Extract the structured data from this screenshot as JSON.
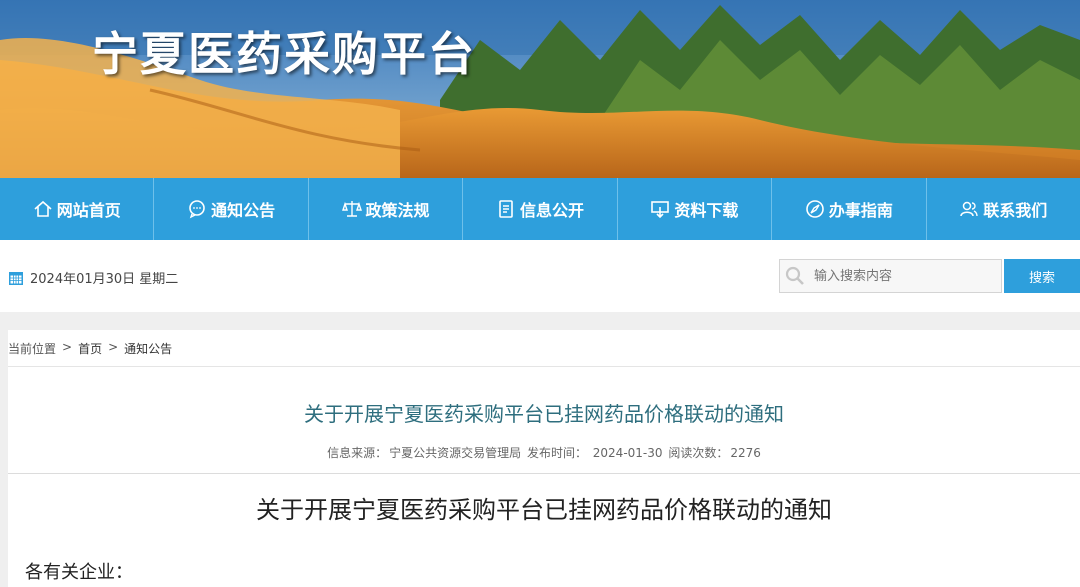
{
  "header": {
    "site_title": "宁夏医药采购平台"
  },
  "nav": {
    "items": [
      {
        "label": "网站首页",
        "icon": "home-icon"
      },
      {
        "label": "通知公告",
        "icon": "chat-bubble-icon"
      },
      {
        "label": "政策法规",
        "icon": "scale-icon"
      },
      {
        "label": "信息公开",
        "icon": "document-icon"
      },
      {
        "label": "资料下载",
        "icon": "download-icon"
      },
      {
        "label": "办事指南",
        "icon": "compass-icon"
      },
      {
        "label": "联系我们",
        "icon": "users-icon"
      }
    ]
  },
  "toolbar": {
    "date": "2024年01月30日 星期二",
    "search_placeholder": "输入搜索内容",
    "search_button": "搜索"
  },
  "breadcrumb": {
    "prefix": "当前位置",
    "sep": ">",
    "home": "首页",
    "section": "通知公告"
  },
  "article": {
    "title": "关于开展宁夏医药采购平台已挂网药品价格联动的通知",
    "source_label": "信息来源：",
    "source": "宁夏公共资源交易管理局",
    "publish_label": "发布时间：",
    "publish_time": "2024-01-30",
    "views_label": "阅读次数：",
    "views": "2276",
    "body_title": "关于开展宁夏医药采购平台已挂网药品价格联动的通知",
    "salutation": "各有关企业："
  },
  "colors": {
    "nav_bg": "#2e9fdc",
    "title_teal": "#2e6e7e"
  }
}
